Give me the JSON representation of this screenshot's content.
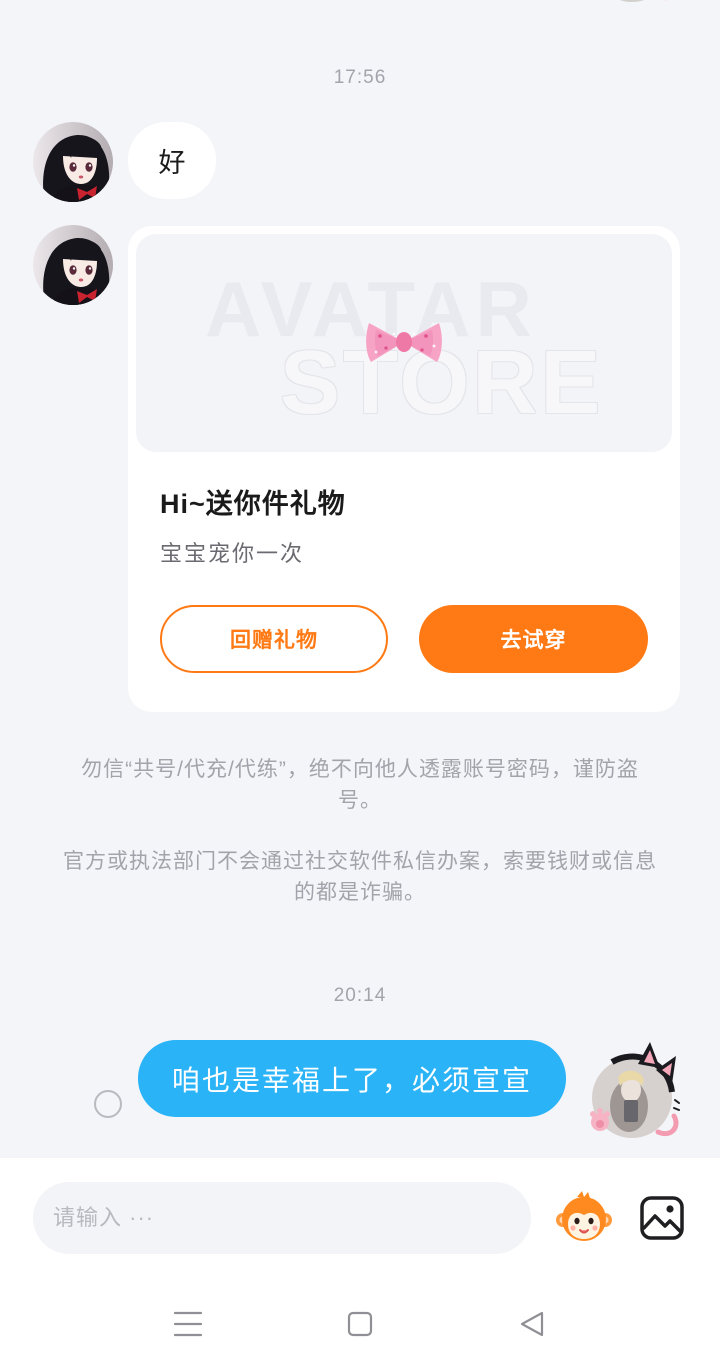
{
  "colors": {
    "chat_background": "#f4f5f9",
    "surface": "#ffffff",
    "accent_orange": "#ff7a14",
    "outgoing_bubble": "#2ab3f6",
    "muted_text": "#a3a3ab",
    "primary_text": "#1a1a1a"
  },
  "conversation": {
    "timestamp_first": "17:56",
    "incoming_message": {
      "text": "好",
      "avatar_icon": "anime-girl-avatar"
    },
    "gift_card": {
      "avatar_icon": "anime-girl-avatar",
      "preview_watermark": [
        "AVATAR",
        "STORE"
      ],
      "preview_icon": "pink-bow-icon",
      "title": "Hi~送你件礼物",
      "subtitle": "宝宝宠你一次",
      "return_gift_label": "回赠礼物",
      "try_on_label": "去试穿"
    },
    "safety_notice": [
      "勿信“共号/代充/代练”，绝不向他人透露账号密码，谨防盗号。",
      "官方或执法部门不会通过社交软件私信办案，索要钱财或信息的都是诈骗。"
    ],
    "timestamp_second": "20:14",
    "outgoing_message": {
      "text": "咱也是幸福上了，必须宣宣",
      "avatar_icon": "cat-ear-avatar"
    }
  },
  "composer": {
    "placeholder": "请输入 ···",
    "emoji_icon": "monkey-emoji-icon",
    "image_icon": "image-icon"
  },
  "system_nav": {
    "icons": [
      "menu-icon",
      "home-square-icon",
      "back-triangle-icon"
    ]
  }
}
